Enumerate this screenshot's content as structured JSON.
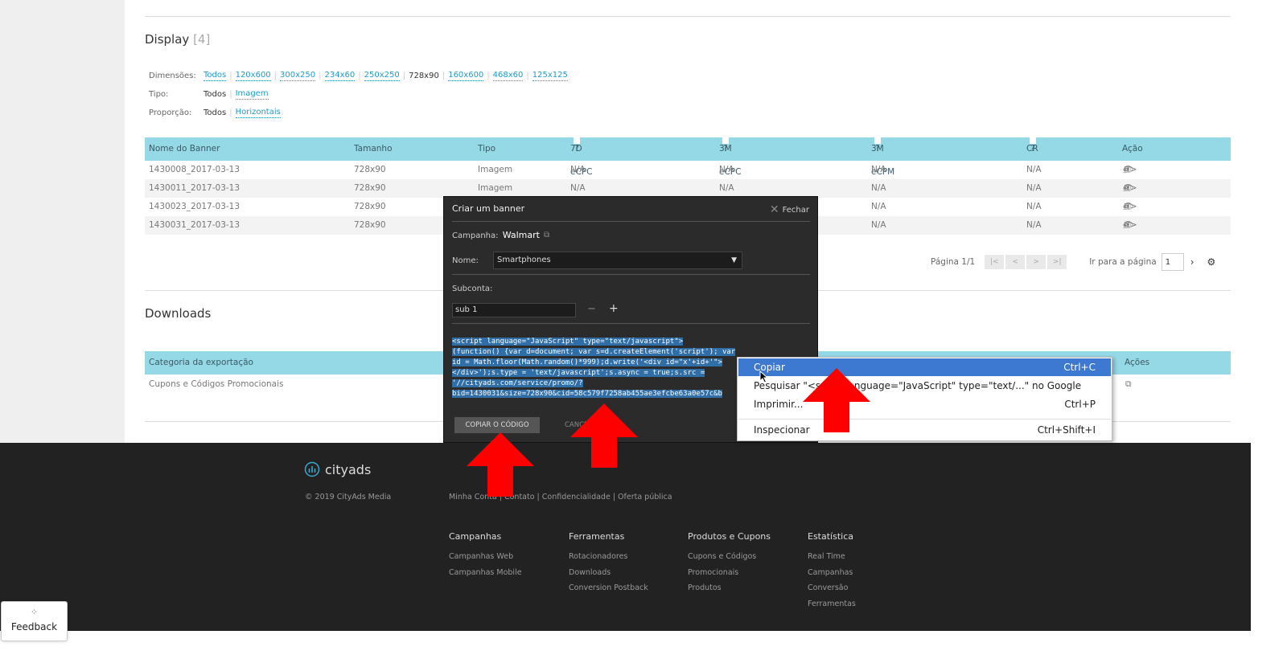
{
  "display": {
    "title": "Display",
    "count": "[4]",
    "filters": {
      "dimensions_label": "Dimensões:",
      "dimensions": [
        "Todos",
        "120x600",
        "300x250",
        "234x60",
        "250x250",
        "728x90",
        "160x600",
        "468x60",
        "125x125"
      ],
      "type_label": "Tipo:",
      "types": [
        "Todos",
        "Imagem"
      ],
      "proportion_label": "Proporção:",
      "proportions": [
        "Todos",
        "Horizontais"
      ]
    },
    "table": {
      "headers": [
        "Nome do Banner",
        "Tamanho",
        "Tipo",
        "7D eCPC",
        "3M eCPC",
        "3M eCPM",
        "CR",
        "Ação"
      ],
      "rows": [
        [
          "1430008_2017-03-13",
          "728x90",
          "Imagem",
          "N/A",
          "N/A",
          "N/A",
          "N/A"
        ],
        [
          "1430011_2017-03-13",
          "728x90",
          "Imagem",
          "N/A",
          "N/A",
          "N/A",
          "N/A"
        ],
        [
          "1430023_2017-03-13",
          "728x90",
          "",
          "",
          "",
          "N/A",
          "N/A"
        ],
        [
          "1430031_2017-03-13",
          "728x90",
          "",
          "",
          "",
          "N/A",
          "N/A"
        ]
      ]
    },
    "pager": {
      "page_text": "Página 1/1",
      "go_to_label": "Ir para a página",
      "page_value": "1"
    }
  },
  "downloads": {
    "title": "Downloads",
    "headers": [
      "Categoria da exportação",
      "Ações"
    ],
    "rows": [
      "Cupons e Códigos Promocionais"
    ]
  },
  "modal": {
    "title": "Criar um banner",
    "close_label": "Fechar",
    "campaign_label": "Campanha:",
    "campaign_value": "Walmart",
    "name_label": "Nome:",
    "name_value": "Smartphones",
    "subaccount_label": "Subconta:",
    "subaccount_value": "sub 1",
    "code_lines": [
      "<script language=\"JavaScript\" type=\"text/javascript\">",
      "(function() {var d=document; var s=d.createElement('script'); var",
      "id = Math.floor(Math.random()*999);d.write('<div id=\"x'+id+'\">",
      "</div>');s.type = 'text/javascript';s.async = true;s.src =",
      "'//cityads.com/service/promo/?",
      "bid=1430031&size=728x90&cid=58c579f7258ab455ae3efcbe63a0e57c&b"
    ],
    "copy_button": "COPIAR O CÓDIGO",
    "cancel_button": "CANCE"
  },
  "context_menu": {
    "items": [
      {
        "label": "Copiar",
        "shortcut": "Ctrl+C"
      },
      {
        "label": "Pesquisar \"<script language=\"JavaScript\" type=\"text/...\" no Google",
        "shortcut": ""
      },
      {
        "label": "Imprimir...",
        "shortcut": "Ctrl+P"
      },
      {
        "label": "Inspecionar",
        "shortcut": "Ctrl+Shift+I"
      }
    ]
  },
  "footer": {
    "brand": "cityads",
    "copyright": "© 2019 CityAds Media",
    "links": "Minha Conta | Contato | Confidencialidade | Oferta pública",
    "columns": [
      {
        "title": "Campanhas",
        "items": [
          "Campanhas Web",
          "Campanhas Mobile"
        ]
      },
      {
        "title": "Ferramentas",
        "items": [
          "Rotacionadores",
          "Downloads",
          "Conversion Postback"
        ]
      },
      {
        "title": "Produtos e Cupons",
        "items": [
          "Cupons e Códigos",
          "Promocionais",
          "Produtos"
        ]
      },
      {
        "title": "Estatística",
        "items": [
          "Real Time",
          "Campanhas",
          "Conversão",
          "Ferramentas"
        ]
      }
    ]
  },
  "feedback": {
    "label": "Feedback"
  },
  "colors": {
    "accent": "#1d9ccb",
    "table_header": "#95d8e6",
    "menu_highlight": "#3d79d1",
    "arrow": "#ff0000"
  }
}
